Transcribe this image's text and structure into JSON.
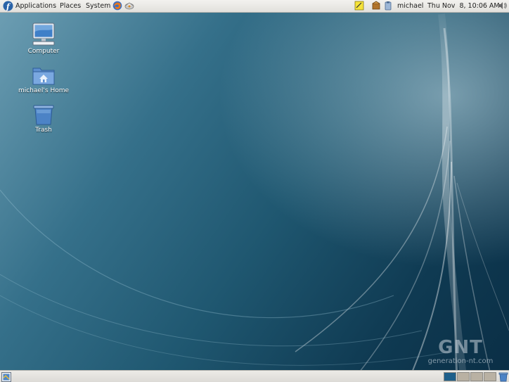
{
  "top_panel": {
    "menus": {
      "applications": "Applications",
      "places": "Places",
      "system": "System"
    },
    "launchers": [
      "firefox-icon",
      "evolution-icon"
    ],
    "tray_icons": [
      "notes-icon",
      "update-icon",
      "clipboard-icon"
    ],
    "user": "michael",
    "clock": "Thu Nov  8, 10:06 AM",
    "volume_icon": "volume-icon"
  },
  "desktop": {
    "icons": [
      {
        "label": "Computer",
        "icon": "computer-icon"
      },
      {
        "label": "michael's Home",
        "icon": "home-folder-icon"
      },
      {
        "label": "Trash",
        "icon": "trash-icon"
      }
    ]
  },
  "bottom_panel": {
    "show_desktop_icon": "show-desktop-icon",
    "workspaces": 4,
    "active_workspace": 1,
    "trash_applet_icon": "trash-applet-icon"
  },
  "watermark": {
    "logo": "GNT",
    "url": "generation-nt.com"
  },
  "colors": {
    "panel": "#e8e6e2",
    "wallpaper_dark": "#0a2e45",
    "wallpaper_light": "#6e9fb4",
    "active_workspace": "#1e5f8a"
  }
}
